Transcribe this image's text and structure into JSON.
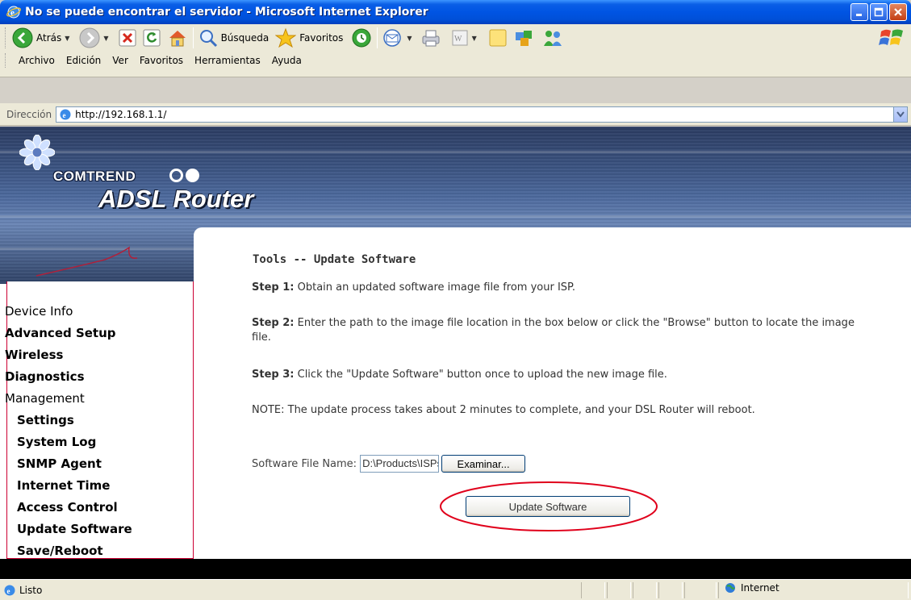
{
  "window": {
    "title": "No se puede encontrar el servidor - Microsoft Internet Explorer",
    "icon": "ie-icon",
    "controls": [
      "minimize-icon",
      "maximize-icon",
      "close-icon"
    ]
  },
  "toolbar": {
    "back_label": "Atrás",
    "search_label": "Búsqueda",
    "favorites_label": "Favoritos"
  },
  "menu": {
    "items": [
      "Archivo",
      "Edición",
      "Ver",
      "Favoritos",
      "Herramientas",
      "Ayuda"
    ]
  },
  "address": {
    "label": "Dirección",
    "url": "http://192.168.1.1/"
  },
  "banner": {
    "brand": "COMTREND",
    "product": "ADSL Router"
  },
  "sidebar": {
    "items": [
      {
        "label": "Device Info",
        "level": 0
      },
      {
        "label": "Advanced Setup",
        "level": 0
      },
      {
        "label": "Wireless",
        "level": 0
      },
      {
        "label": "Diagnostics",
        "level": 0
      },
      {
        "label": "Management",
        "level": 0
      },
      {
        "label": "Settings",
        "level": 1
      },
      {
        "label": "System Log",
        "level": 1
      },
      {
        "label": "SNMP Agent",
        "level": 1
      },
      {
        "label": "Internet Time",
        "level": 1
      },
      {
        "label": "Access Control",
        "level": 1
      },
      {
        "label": "Update Software",
        "level": 1
      },
      {
        "label": "Save/Reboot",
        "level": 1
      }
    ]
  },
  "main": {
    "heading": "Tools -- Update Software",
    "step1_label": "Step 1:",
    "step1_text": " Obtain an updated software image file from your ISP.",
    "step2_label": "Step 2:",
    "step2_text": " Enter the path to the image file location in the box below or click the \"Browse\" button to locate the image file.",
    "step3_label": "Step 3:",
    "step3_text": " Click the \"Update Software\" button once to upload the new image file.",
    "note": "NOTE: The update process takes about 2 minutes to complete, and your DSL Router will reboot.",
    "file_label": "Software File Name:",
    "file_value": "D:\\Products\\ISPs\\Ja",
    "browse_label": "Examinar...",
    "update_label": "Update Software",
    "highlight_color": "#e0001b"
  },
  "status": {
    "text": "Listo",
    "zone": "Internet"
  }
}
